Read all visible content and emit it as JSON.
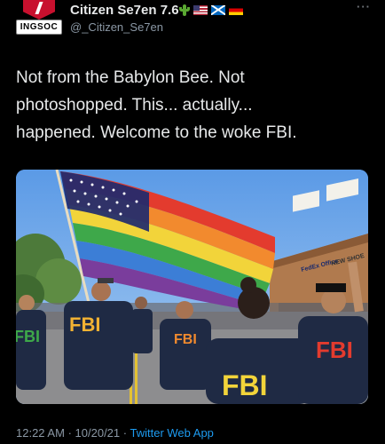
{
  "author": {
    "display_name": "Citizen Se7en 7.6",
    "handle": "@_Citizen_Se7en",
    "avatar_label": "INGSOC",
    "badges": [
      "cactus-icon",
      "flag-us-icon",
      "flag-scotland-icon",
      "flag-germany-icon"
    ]
  },
  "menu": {
    "more_label": "···"
  },
  "tweet": {
    "lines": [
      "Not from the Babylon Bee. Not",
      "photoshopped. This... actually...",
      "happened. Welcome to the woke FBI."
    ]
  },
  "media": {
    "signs": [
      "FedEx Office",
      "NEW SHOE"
    ],
    "shirt_text": "FBI"
  },
  "meta": {
    "time": "12:22 AM",
    "separator": "·",
    "date": "10/20/21",
    "app": "Twitter Web App"
  },
  "colors": {
    "background": "#000000",
    "text": "#e7e9ea",
    "secondary": "#8b98a5",
    "link": "#1d9bf0"
  }
}
